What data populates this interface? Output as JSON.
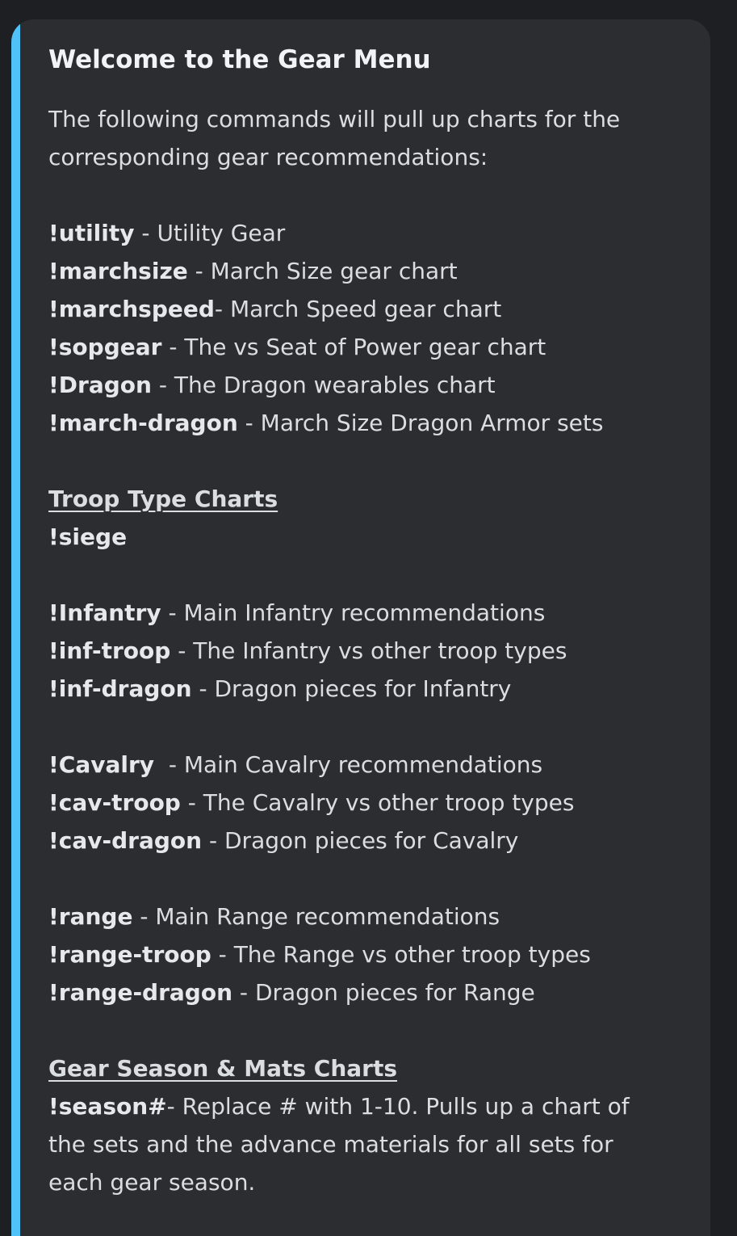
{
  "embed": {
    "accent_color": "#4fc3f7",
    "title": "Welcome to the Gear Menu",
    "intro": [
      "The following commands will pull up charts for the",
      "corresponding gear recommendations:"
    ],
    "utility_commands": [
      {
        "cmd": "!utility",
        "sep": " - ",
        "desc": "Utility Gear"
      },
      {
        "cmd": "!marchsize",
        "sep": " - ",
        "desc": "March Size gear chart"
      },
      {
        "cmd": "!marchspeed",
        "sep": "- ",
        "desc": "March Speed gear chart"
      },
      {
        "cmd": "!sopgear",
        "sep": " - ",
        "desc": "The vs Seat of Power gear chart"
      },
      {
        "cmd": "!Dragon",
        "sep": " - ",
        "desc": "The Dragon wearables chart"
      },
      {
        "cmd": "!march-dragon",
        "sep": " - ",
        "desc": "March Size Dragon Armor sets"
      }
    ],
    "troop_heading": "Troop Type Charts",
    "siege_cmd": "!siege",
    "infantry_commands": [
      {
        "cmd": "!Infantry",
        "sep": " - ",
        "desc": "Main Infantry recommendations"
      },
      {
        "cmd": "!inf-troop",
        "sep": " - ",
        "desc": "The Infantry vs other troop types"
      },
      {
        "cmd": "!inf-dragon",
        "sep": " - ",
        "desc": "Dragon pieces for Infantry"
      }
    ],
    "cavalry_commands": [
      {
        "cmd": "!Cavalry",
        "sep": "  - ",
        "desc": "Main Cavalry recommendations"
      },
      {
        "cmd": "!cav-troop",
        "sep": " - ",
        "desc": "The Cavalry vs other troop types"
      },
      {
        "cmd": "!cav-dragon",
        "sep": " - ",
        "desc": "Dragon pieces for Cavalry"
      }
    ],
    "range_commands": [
      {
        "cmd": "!range",
        "sep": " - ",
        "desc": "Main Range recommendations"
      },
      {
        "cmd": "!range-troop",
        "sep": " - ",
        "desc": "The Range vs other troop types"
      },
      {
        "cmd": "!range-dragon",
        "sep": " - ",
        "desc": "Dragon pieces for Range"
      }
    ],
    "season_heading": "Gear Season & Mats Charts",
    "season": {
      "cmd": "!season#",
      "sep": "- ",
      "lines": [
        "Replace # with 1-10. Pulls up a chart of",
        "the sets and the advance materials for all sets for",
        "each gear season."
      ]
    }
  }
}
